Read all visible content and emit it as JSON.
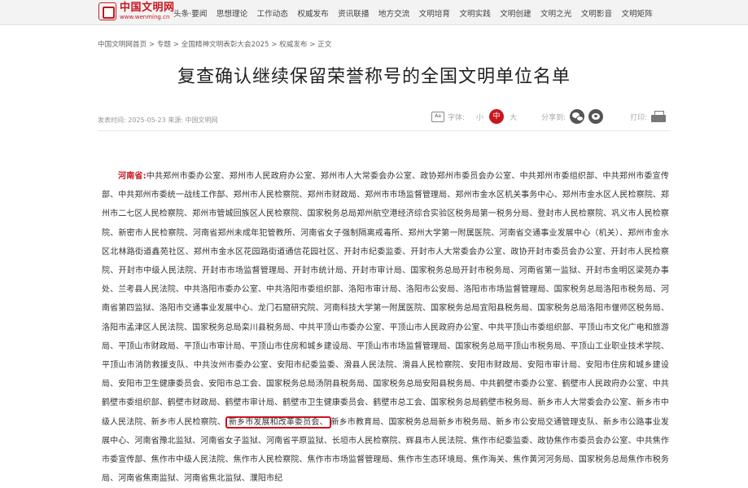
{
  "site": {
    "logo_cn": "中国文明网",
    "logo_en": "www.wenming.cn"
  },
  "nav": [
    "头条·要闻",
    "思想理论",
    "工作动态",
    "权威发布",
    "资讯联播",
    "地方交流",
    "文明培育",
    "文明实践",
    "文明创建",
    "文明之光",
    "文明影音",
    "文明矩阵"
  ],
  "breadcrumb": "中国文明网首页 > 专题 > 全国精神文明表彰大会2025 > 权威发布 > 正文",
  "title": "复查确认继续保留荣誉称号的全国文明单位名单",
  "meta": "发表时间: 2025-05-23 来源: 中国文明网",
  "tools": {
    "font_icon": "Aa",
    "font_label": "字体:",
    "small": "小",
    "medium": "中",
    "large": "大",
    "share_label": "分享到:",
    "print_label": "打印:"
  },
  "icons": {
    "wechat": "wechat-icon",
    "weibo": "weibo-icon",
    "printer": "printer-icon",
    "font": "font-size-icon"
  },
  "colors": {
    "brand_red": "#c8161d",
    "highlight_box": "#d01020"
  },
  "content": {
    "province": "河南省:",
    "text_before": "中共郑州市委办公室、郑州市人民政府办公室、郑州市人大常委会办公室、政协郑州市委员会办公室、中共郑州市委组织部、中共郑州市委宣传部、中共郑州市委统一战线工作部、郑州市人民检察院、郑州市财政局、郑州市市场监督管理局、郑州市金水区机关事务中心、郑州市金水区人民检察院、郑州市二七区人民检察院、郑州市管城回族区人民检察院、国家税务总局郑州航空港经济综合实验区税务局第一税务分局、登封市人民检察院、巩义市人民检察院、新密市人民检察院、河南省郑州未成年犯管教所、河南省女子强制隔离戒毒所、郑州大学第一附属医院、河南省交通事业发展中心（机关）、郑州市金水区北林路街道鑫苑社区、郑州市金水区花园路街道通信花园社区、开封市纪委监委、开封市人大常委会办公室、政协开封市委员会办公室、开封市人民检察院、开封市中级人民法院、开封市市场监督管理局、开封市统计局、开封市审计局、国家税务总局开封市税务局、河南省第一监狱、开封市金明区梁苑办事处、兰考县人民法院、中共洛阳市委办公室、中共洛阳市委组织部、洛阳市审计局、洛阳市公安局、洛阳市市场监督管理局、国家税务总局洛阳市税务局、河南省第四监狱、洛阳市交通事业发展中心、龙门石窟研究院、河南科技大学第一附属医院、国家税务总局宜阳县税务局、国家税务总局洛阳市偃师区税务局、洛阳市孟津区人民法院、国家税务总局栾川县税务局、中共平顶山市委办公室、平顶山市人民政府办公室、中共平顶山市委组织部、平顶山市文化广电和旅游局、平顶山市财政局、平顶山市审计局、平顶山市住房和城乡建设局、平顶山市市场监督管理局、国家税务总局平顶山市税务局、平顶山工业职业技术学院、平顶山市消防救援支队、中共汝州市委办公室、安阳市纪委监委、滑县人民法院、滑县人民检察院、安阳市财政局、安阳市审计局、安阳市住房和城乡建设局、安阳市卫生健康委员会、安阳市总工会、国家税务总局汤阴县税务局、国家税务总局安阳县税务局、中共鹤壁市委办公室、鹤壁市人民政府办公室、中共鹤壁市委组织部、鹤壁市财政局、鹤壁市审计局、鹤壁市卫生健康委员会、鹤壁市总工会、国家税务总局鹤壁市税务局、新乡市人大常委会办公室、新乡市中级人民法院、新乡市人民检察院、",
    "highlight": "新乡市发展和改革委员会、",
    "text_after": "新乡市教育局、国家税务总局新乡市税务局、新乡市公安局交通管理支队、新乡市公路事业发展中心、河南省豫北监狱、河南省女子监狱、河南省平原监狱、长垣市人民检察院、辉县市人民法院、焦作市纪委监委、政协焦作市委员会办公室、中共焦作市委宣传部、焦作市中级人民法院、焦作市人民检察院、焦作市市场监督管理局、焦作市生态环境局、焦作海关、焦作黄河河务局、国家税务总局焦作市税务局、河南省焦南监狱、河南省焦北监狱、濮阳市纪"
  }
}
